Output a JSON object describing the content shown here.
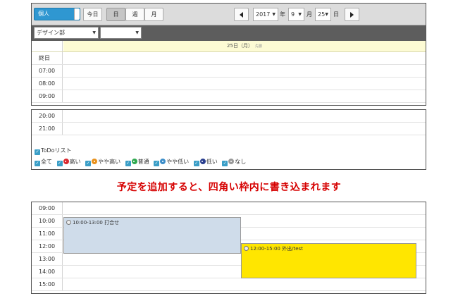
{
  "toolbar": {
    "scope_toggle": "個人",
    "today": "今日",
    "day": "日",
    "week": "週",
    "month": "月",
    "year_value": "2017",
    "year_label": "年",
    "month_value": "9",
    "month_label": "月",
    "day_value": "25",
    "day_label": "日",
    "caret": "▼"
  },
  "filters": {
    "department": "デザイン部",
    "user": ""
  },
  "day_header": {
    "date": "25日（月）",
    "rokuyo": "先勝"
  },
  "panel1_rows": [
    "終日",
    "07:00",
    "08:00",
    "09:00"
  ],
  "panel2_rows": [
    "20:00",
    "21:00"
  ],
  "todo": {
    "title": "ToDoリスト",
    "filters": [
      {
        "label": "全て",
        "color": ""
      },
      {
        "label": "高い",
        "color": "#d9282f"
      },
      {
        "label": "やや高い",
        "color": "#e8911c"
      },
      {
        "label": "普通",
        "color": "#2fa84f"
      },
      {
        "label": "やや低い",
        "color": "#3d8ec9"
      },
      {
        "label": "低い",
        "color": "#2a3f8f"
      },
      {
        "label": "なし",
        "color": "#999999"
      }
    ]
  },
  "caption": "予定を追加すると、四角い枠内に書き込まれます",
  "panel3_rows": [
    "09:00",
    "10:00",
    "11:00",
    "12:00",
    "13:00",
    "14:00",
    "15:00"
  ],
  "events": [
    {
      "time": "10:00-13:00",
      "title": "打合せ",
      "color": "#cfdcea"
    },
    {
      "time": "12:00-15:00",
      "title": "外出/test",
      "color": "#ffe600"
    }
  ]
}
